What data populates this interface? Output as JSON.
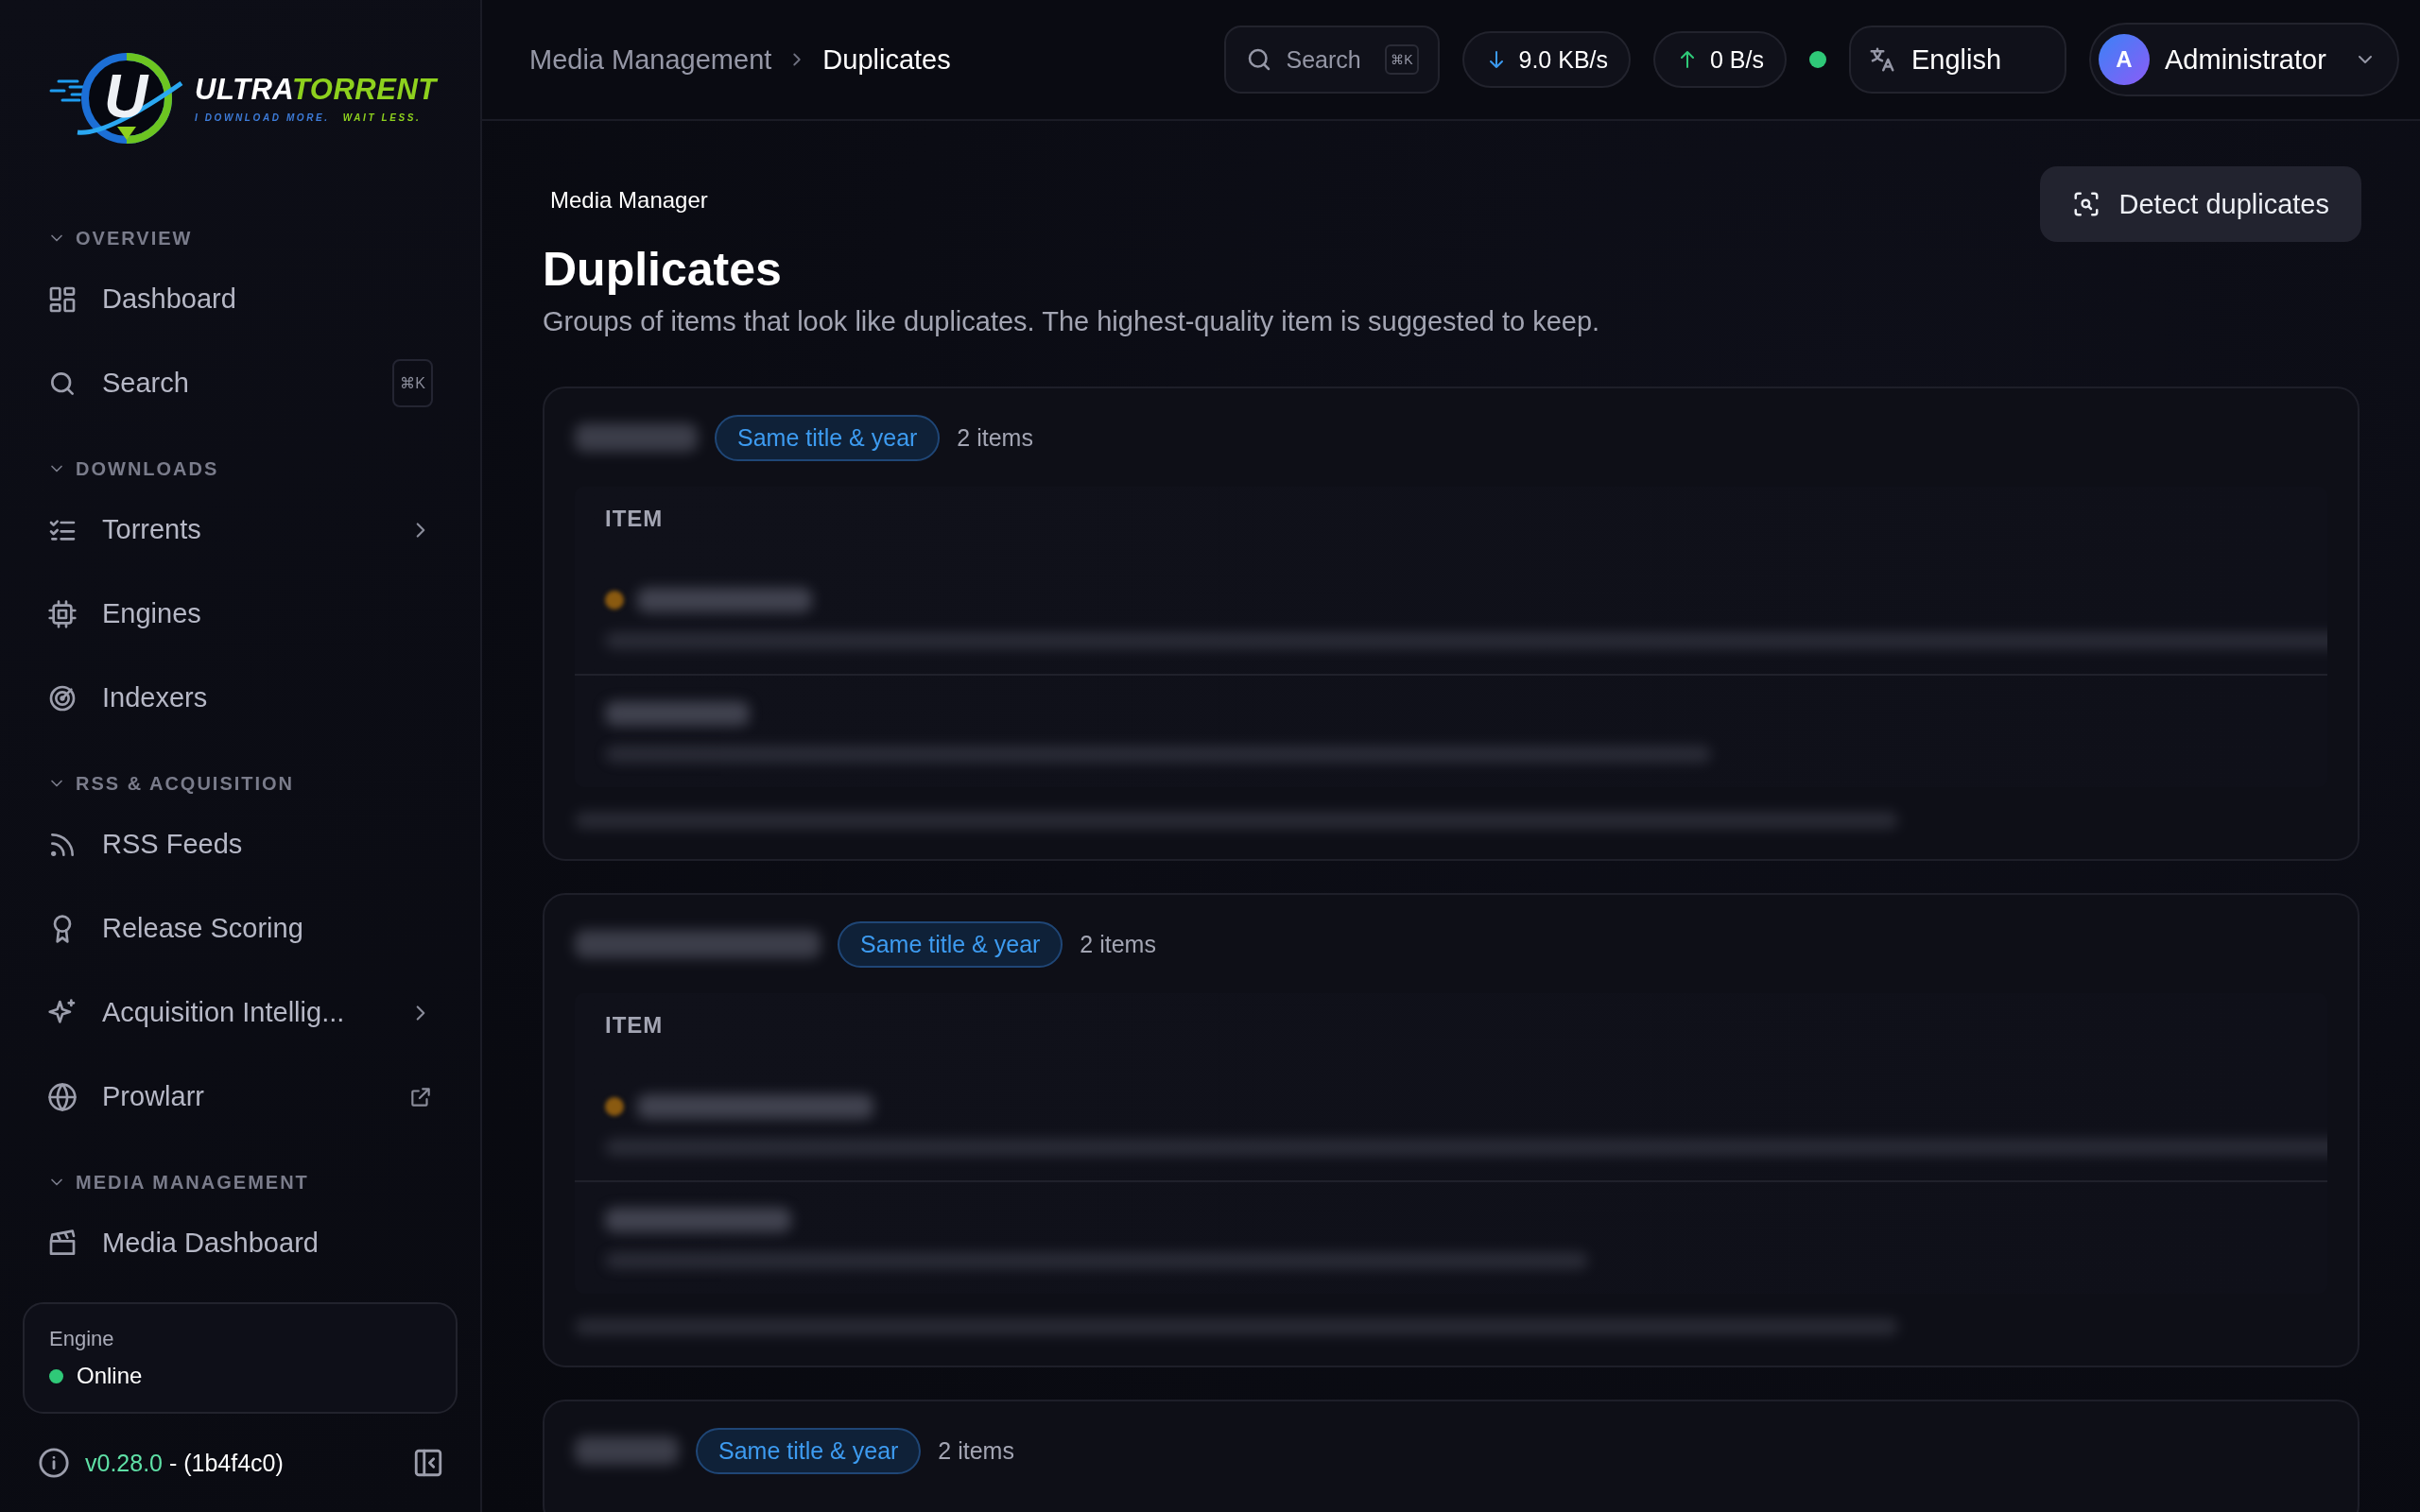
{
  "logo": {
    "mark": "U",
    "name": "ULTRA",
    "name_accent": "TORRENT",
    "tagline": "I DOWNLOAD MORE.",
    "tagline_accent": "WAIT LESS."
  },
  "sidebar": {
    "sections": [
      {
        "title": "OVERVIEW",
        "expanded": true,
        "items": [
          {
            "label": "Dashboard"
          },
          {
            "label": "Search",
            "kind": "shortcut",
            "shortcut": "⌘K"
          }
        ]
      },
      {
        "title": "DOWNLOADS",
        "expanded": true,
        "items": [
          {
            "label": "Torrents",
            "kind": "submenu"
          },
          {
            "label": "Engines"
          },
          {
            "label": "Indexers"
          }
        ]
      },
      {
        "title": "RSS & ACQUISITION",
        "expanded": true,
        "items": [
          {
            "label": "RSS Feeds"
          },
          {
            "label": "Release Scoring"
          },
          {
            "label": "Acquisition Intellig...",
            "kind": "submenu"
          },
          {
            "label": "Prowlarr",
            "kind": "external"
          }
        ]
      },
      {
        "title": "MEDIA MANAGEMENT",
        "expanded": true,
        "items": [
          {
            "label": "Media Dashboard"
          }
        ]
      }
    ],
    "engine": {
      "label": "Engine",
      "status": "Online",
      "online": true
    },
    "version": {
      "number": "v0.28.0",
      "build": "- (1b4f4c0)"
    }
  },
  "topbar": {
    "breadcrumb": [
      {
        "label": "Media Management",
        "current": false
      },
      {
        "label": "Duplicates",
        "current": true
      }
    ],
    "search": {
      "placeholder": "Search",
      "shortcut": "⌘K"
    },
    "download_rate": "9.0 KB/s",
    "upload_rate": "0 B/s",
    "connected": true,
    "language": "English",
    "user": {
      "initial": "A",
      "name": "Administrator"
    }
  },
  "page": {
    "eyebrow": "Media Manager",
    "title": "Duplicates",
    "subtitle": "Groups of items that look like duplicates. The highest-quality item is suggested to keep.",
    "action": "Detect duplicates"
  },
  "groups": [
    {
      "match": "Same title & year",
      "count": "2 items",
      "column": "ITEM",
      "rows": [
        {
          "suggested": true
        },
        {
          "suggested": false
        }
      ]
    },
    {
      "match": "Same title & year",
      "count": "2 items",
      "column": "ITEM",
      "rows": [
        {
          "suggested": true
        },
        {
          "suggested": false
        }
      ]
    },
    {
      "match": "Same title & year",
      "count": "2 items"
    }
  ]
}
